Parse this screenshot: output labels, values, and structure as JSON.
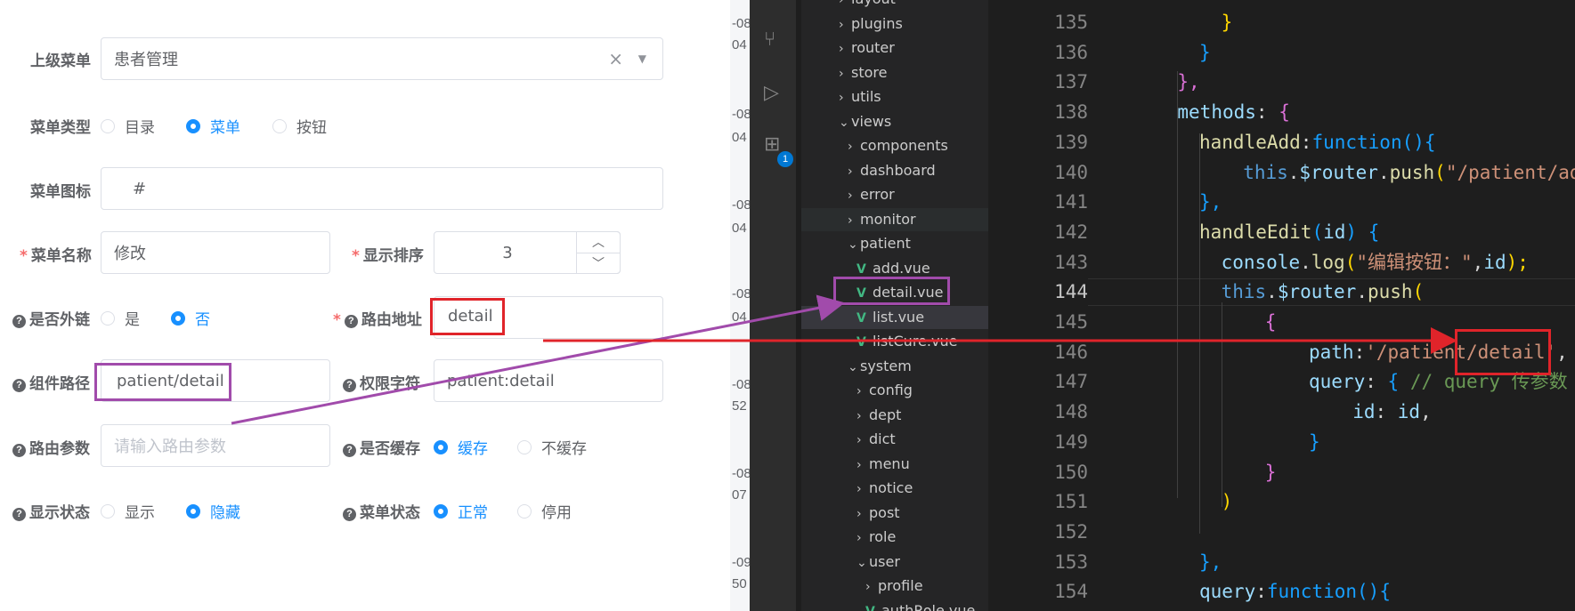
{
  "form": {
    "parent_menu": {
      "label": "上级菜单",
      "value": "患者管理"
    },
    "menu_type": {
      "label": "菜单类型",
      "options": [
        "目录",
        "菜单",
        "按钮"
      ],
      "selected": "菜单"
    },
    "menu_icon": {
      "label": "菜单图标",
      "value": "#"
    },
    "menu_name": {
      "label": "菜单名称",
      "value": "修改"
    },
    "sort_order": {
      "label": "显示排序",
      "value": "3"
    },
    "external_link": {
      "label": "是否外链",
      "options": [
        "是",
        "否"
      ],
      "selected": "否"
    },
    "route_path": {
      "label": "路由地址",
      "value": "detail"
    },
    "component_path": {
      "label": "组件路径",
      "value": "patient/detail"
    },
    "permission": {
      "label": "权限字符",
      "value": "patient:detail"
    },
    "route_params": {
      "label": "路由参数",
      "placeholder": "请输入路由参数"
    },
    "cache": {
      "label": "是否缓存",
      "options": [
        "缓存",
        "不缓存"
      ],
      "selected": "缓存"
    },
    "visible": {
      "label": "显示状态",
      "options": [
        "显示",
        "隐藏"
      ],
      "selected": "隐藏"
    },
    "menu_status": {
      "label": "菜单状态",
      "options": [
        "正常",
        "停用"
      ],
      "selected": "正常"
    }
  },
  "edge_strip": [
    "-08",
    "04",
    "-08",
    "04",
    "-08",
    "04",
    "-08",
    "04",
    "-08",
    "52",
    "-08",
    "07",
    "-09",
    "50"
  ],
  "activity_bar": {
    "icons": [
      "source-control-icon",
      "run-debug-icon",
      "extensions-icon"
    ],
    "badge": "1"
  },
  "file_tree": [
    {
      "name": "layout",
      "type": "folder",
      "open": false
    },
    {
      "name": "plugins",
      "type": "folder",
      "open": false
    },
    {
      "name": "router",
      "type": "folder",
      "open": false
    },
    {
      "name": "store",
      "type": "folder",
      "open": false
    },
    {
      "name": "utils",
      "type": "folder",
      "open": false
    },
    {
      "name": "views",
      "type": "folder",
      "open": true
    },
    {
      "name": "components",
      "type": "folder",
      "open": false
    },
    {
      "name": "dashboard",
      "type": "folder",
      "open": false
    },
    {
      "name": "error",
      "type": "folder",
      "open": false
    },
    {
      "name": "monitor",
      "type": "folder",
      "open": false
    },
    {
      "name": "patient",
      "type": "folder",
      "open": true
    },
    {
      "name": "add.vue",
      "type": "vue"
    },
    {
      "name": "detail.vue",
      "type": "vue"
    },
    {
      "name": "list.vue",
      "type": "vue"
    },
    {
      "name": "listCure.vue",
      "type": "vue"
    },
    {
      "name": "system",
      "type": "folder",
      "open": true
    },
    {
      "name": "config",
      "type": "folder",
      "open": false
    },
    {
      "name": "dept",
      "type": "folder",
      "open": false
    },
    {
      "name": "dict",
      "type": "folder",
      "open": false
    },
    {
      "name": "menu",
      "type": "folder",
      "open": false
    },
    {
      "name": "notice",
      "type": "folder",
      "open": false
    },
    {
      "name": "post",
      "type": "folder",
      "open": false
    },
    {
      "name": "role",
      "type": "folder",
      "open": false
    },
    {
      "name": "user",
      "type": "folder",
      "open": true
    },
    {
      "name": "profile",
      "type": "folder",
      "open": false
    },
    {
      "name": "authRole.vue",
      "type": "vue"
    }
  ],
  "editor": {
    "current_line": "144",
    "line_numbers": [
      "135",
      "136",
      "137",
      "138",
      "139",
      "140",
      "141",
      "142",
      "143",
      "144",
      "145",
      "146",
      "147",
      "148",
      "149",
      "150",
      "151",
      "152",
      "153",
      "154"
    ],
    "code": [
      [
        [
          "}",
          "y"
        ]
      ],
      [
        [
          "}",
          "b"
        ]
      ],
      [
        [
          "},",
          "m"
        ]
      ],
      [
        [
          "methods",
          "p"
        ],
        [
          ": ",
          "d"
        ],
        [
          "{",
          "m"
        ]
      ],
      [
        [
          "handleAdd",
          "f"
        ],
        [
          ":",
          "d"
        ],
        [
          "function",
          "b"
        ],
        [
          "(){",
          "b"
        ]
      ],
      [
        [
          "this",
          "k"
        ],
        [
          ".",
          "d"
        ],
        [
          "$router",
          "p"
        ],
        [
          ".",
          "d"
        ],
        [
          "push",
          "f"
        ],
        [
          "(",
          "y"
        ],
        [
          "\"/patient/add",
          "s"
        ]
      ],
      [
        [
          "},",
          "b"
        ]
      ],
      [
        [
          "handleEdit",
          "f"
        ],
        [
          "(",
          "b"
        ],
        [
          "id",
          "p"
        ],
        [
          ") ",
          "b"
        ],
        [
          "{",
          "b"
        ]
      ],
      [
        [
          "console",
          "p"
        ],
        [
          ".",
          "d"
        ],
        [
          "log",
          "f"
        ],
        [
          "(",
          "y"
        ],
        [
          "\"编辑按钮：\"",
          "s"
        ],
        [
          ",",
          "d"
        ],
        [
          "id",
          "p"
        ],
        [
          ");",
          "y"
        ]
      ],
      [
        [
          "this",
          "k"
        ],
        [
          ".",
          "d"
        ],
        [
          "$router",
          "p"
        ],
        [
          ".",
          "d"
        ],
        [
          "push",
          "f"
        ],
        [
          "(",
          "y"
        ]
      ],
      [
        [
          "{",
          "m"
        ]
      ],
      [
        [
          "path",
          "p"
        ],
        [
          ":",
          "d"
        ],
        [
          "'/patient/detail'",
          "s"
        ],
        [
          ",",
          "d"
        ]
      ],
      [
        [
          "query",
          "p"
        ],
        [
          ": ",
          "d"
        ],
        [
          "{ ",
          "b"
        ],
        [
          "// query 传参数",
          "c"
        ]
      ],
      [
        [
          "id",
          "p"
        ],
        [
          ": ",
          "d"
        ],
        [
          "id",
          "p"
        ],
        [
          ",",
          "d"
        ]
      ],
      [
        [
          "}",
          "b"
        ]
      ],
      [
        [
          "}",
          "m"
        ]
      ],
      [
        [
          ")",
          "y"
        ]
      ],
      [
        [
          "",
          "d"
        ]
      ],
      [
        [
          "},",
          "b"
        ]
      ],
      [
        [
          "query",
          "p"
        ],
        [
          ":",
          "d"
        ],
        [
          "function",
          "b"
        ],
        [
          "(){",
          "b"
        ]
      ]
    ]
  },
  "colors": {
    "accent": "#1890ff",
    "highlight_red": "#e0242a",
    "highlight_purple": "#a14bab",
    "editor_bg": "#1e1e1e",
    "sidebar_bg": "#252526"
  }
}
